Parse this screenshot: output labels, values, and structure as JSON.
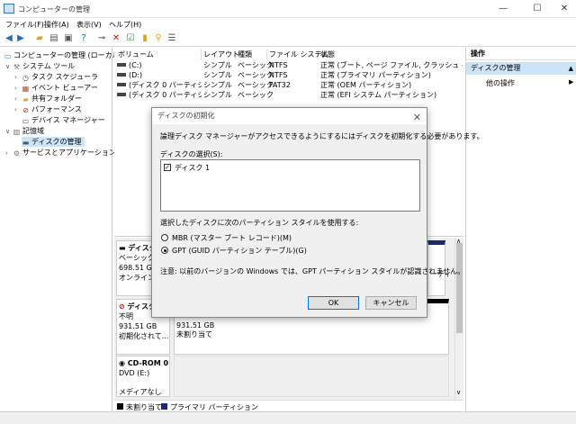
{
  "window": {
    "title": "コンピューターの管理",
    "minimize_glyph": "—",
    "maximize_glyph": "☐",
    "close_glyph": "✕"
  },
  "menu": [
    "ファイル(F)",
    "操作(A)",
    "表示(V)",
    "ヘルプ(H)"
  ],
  "toolbar_icons": [
    "back-arrow-icon",
    "forward-arrow-icon",
    "folder-up-icon",
    "console-tree-icon",
    "properties-icon",
    "help-icon",
    "connect-icon",
    "delete-icon",
    "check-icon",
    "open-folder-icon",
    "search-icon",
    "details-icon"
  ],
  "tree": {
    "root": "コンピューターの管理 (ローカル)",
    "system_tools": "システム ツール",
    "task_scheduler": "タスク スケジューラ",
    "event_viewer": "イベント ビューアー",
    "shared_folders": "共有フォルダー",
    "performance": "パフォーマンス",
    "device_manager": "デバイス マネージャー",
    "storage": "記憶域",
    "disk_management": "ディスクの管理",
    "services_apps": "サービスとアプリケーション"
  },
  "volume_list": {
    "headers": [
      "ボリューム",
      "レイアウト",
      "種類",
      "ファイル システム",
      "状態"
    ],
    "rows": [
      [
        "(C:)",
        "シンプル",
        "ベーシック",
        "NTFS",
        "正常 (ブート, ページ ファイル, クラッシュ ダンプ, プライマリ"
      ],
      [
        "(D:)",
        "シンプル",
        "ベーシック",
        "NTFS",
        "正常 (プライマリ パーティション)"
      ],
      [
        "(ディスク 0 パーティション 1)",
        "シンプル",
        "ベーシック",
        "FAT32",
        "正常 (OEM パーティション)"
      ],
      [
        "(ディスク 0 パーティション 2)",
        "シンプル",
        "ベーシック",
        "",
        "正常 (EFI システム パーティション)"
      ]
    ]
  },
  "disk_map": {
    "disk0": {
      "name": "ディスク",
      "type": "ベーシック",
      "size": "698.51 GB",
      "status": "オンライン",
      "partition_tail": "ーティ"
    },
    "disk1": {
      "name": "ディスク",
      "status": "不明",
      "size": "931.51 GB",
      "state": "初期化されて...",
      "part_size": "931.51 GB",
      "part_label": "未割り当て"
    },
    "cdrom": {
      "name": "CD-ROM 0",
      "drive": "DVD (E:)",
      "media": "メディアなし"
    }
  },
  "legend": {
    "unallocated": "未割り当て",
    "primary": "プライマリ パーティション",
    "unallocated_color": "#000000",
    "primary_color": "#1a2a6c"
  },
  "actions": {
    "header": "操作",
    "selected": "ディスクの管理",
    "other": "他の操作"
  },
  "dialog": {
    "title": "ディスクの初期化",
    "message": "論理ディスク マネージャーがアクセスできるようにするにはディスクを初期化する必要があります。",
    "select_label": "ディスクの選択(S):",
    "disk_item": "ディスク 1",
    "style_label": "選択したディスクに次のパーティション スタイルを使用する:",
    "mbr": "MBR (マスター ブート レコード)(M)",
    "gpt": "GPT (GUID パーティション テーブル)(G)",
    "note": "注意: 以前のバージョンの Windows では、GPT パーティション スタイルが認識されません。",
    "ok": "OK",
    "cancel": "キャンセル",
    "gpt_selected": true
  }
}
